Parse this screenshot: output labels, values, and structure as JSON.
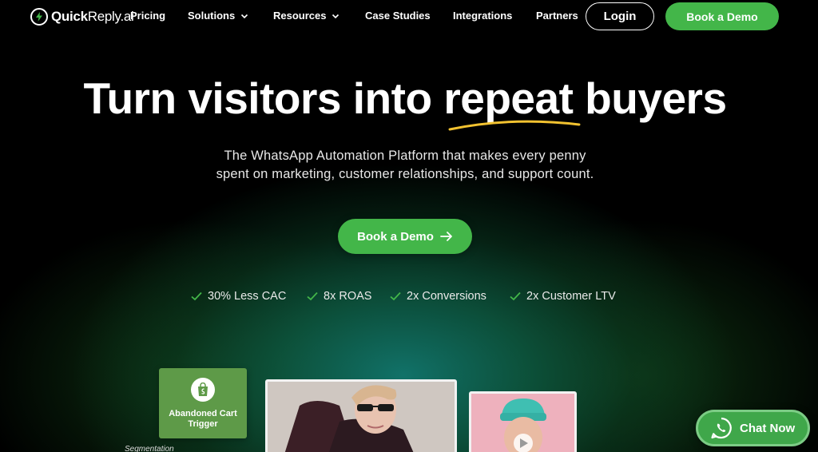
{
  "nav": {
    "logo_bold": "Quick",
    "logo_thin": "Reply.ai",
    "items": [
      {
        "label": "Pricing"
      },
      {
        "label": "Solutions"
      },
      {
        "label": "Resources"
      },
      {
        "label": "Case Studies"
      },
      {
        "label": "Integrations"
      },
      {
        "label": "Partners"
      }
    ],
    "login_label": "Login",
    "demo_label": "Book a Demo"
  },
  "hero": {
    "headline": "Turn visitors into repeat buyers",
    "subtext_line1": "The WhatsApp Automation Platform that makes every penny",
    "subtext_line2": "spent on marketing, customer relationships, and support count.",
    "cta_label": "Book a Demo",
    "benefits": [
      {
        "label": "30% Less CAC"
      },
      {
        "label": "8x ROAS"
      },
      {
        "label": "2x Conversions"
      },
      {
        "label": "2x Customer LTV"
      }
    ]
  },
  "preview": {
    "trigger_line1": "Abandoned Cart",
    "trigger_line2": "Trigger",
    "segmentation_label": "Segmentation"
  },
  "chat_widget": {
    "label": "Chat Now"
  },
  "colors": {
    "brand_green": "#43b649",
    "accent_yellow": "#f2c230",
    "background": "#000000"
  }
}
